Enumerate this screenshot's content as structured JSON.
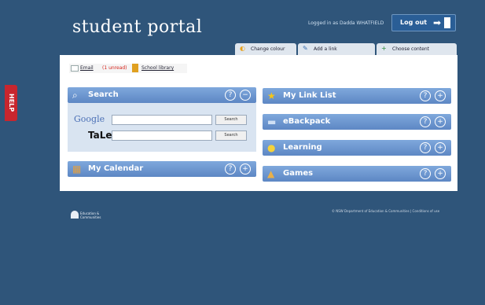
{
  "help": {
    "label": "HELP"
  },
  "header": {
    "title": "student portal",
    "logged_in": "Logged in as Dadda WHATFIELD",
    "logout_label": "Log out"
  },
  "tabs": [
    {
      "label": "Change colour",
      "icon": "palette-icon"
    },
    {
      "label": "Add a link",
      "icon": "pencil-icon"
    },
    {
      "label": "Choose content",
      "icon": "plus-icon"
    }
  ],
  "toolbar": {
    "email_label": "Email",
    "unread_label": "(1 unread)",
    "library_label": "School library"
  },
  "widgets": {
    "search": {
      "title": "Search"
    },
    "calendar": {
      "title": "My Calendar"
    },
    "links": {
      "title": "My Link List"
    },
    "backpack": {
      "title": "eBackpack"
    },
    "learning": {
      "title": "Learning"
    },
    "games": {
      "title": "Games"
    }
  },
  "search": {
    "google_logo": "Google",
    "tale_logo": "TaLe",
    "button_label": "Search"
  },
  "footer": {
    "logo_text": "Education & Communities",
    "copyright": "© NSW Department of Education & Communities | Conditions of use"
  },
  "colors": {
    "background": "#2f557a",
    "widget_blue": "#6d97cf",
    "help_red": "#c8262e"
  }
}
